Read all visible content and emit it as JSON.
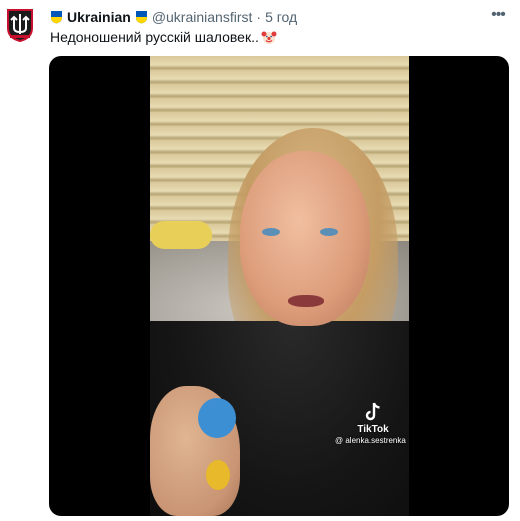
{
  "tweet": {
    "display_name": "Ukrainian",
    "handle": "@ukrainiansfirst",
    "separator": "·",
    "time": "5 год",
    "more_label": "•••",
    "text": "Недоношений русскій шаловек..",
    "icons": [
      "trident-avatar-icon",
      "ukraine-shield-icon",
      "clown-emoji-icon",
      "more-icon"
    ]
  },
  "media": {
    "tiktok_label": "TikTok",
    "tiktok_user": "@ alenka.sestrenka"
  },
  "colors": {
    "text_primary": "#0f1419",
    "text_secondary": "#536471",
    "media_background": "#000000",
    "ukraine_blue": "#0057b7",
    "ukraine_yellow": "#ffd700",
    "avatar_red": "#c8102e"
  }
}
